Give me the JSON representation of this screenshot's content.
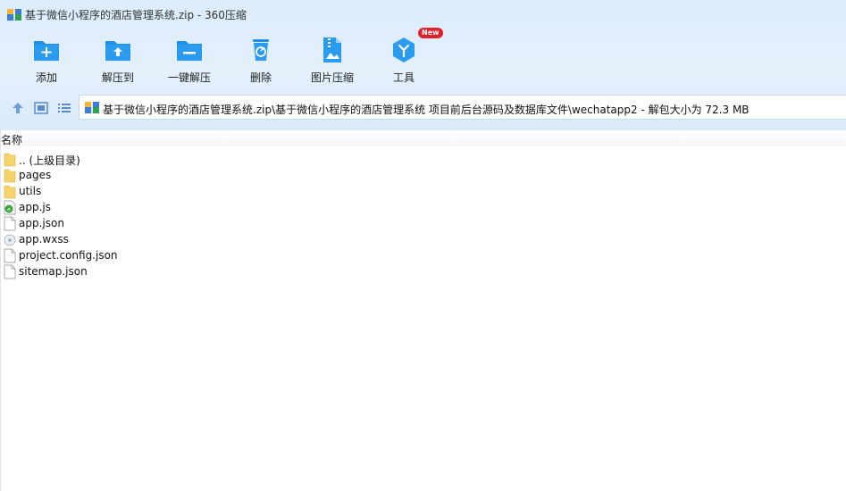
{
  "window": {
    "title": "基于微信小程序的酒店管理系统.zip - 360压缩"
  },
  "toolbar": {
    "items": [
      {
        "label": "添加",
        "icon": "add-folder-icon"
      },
      {
        "label": "解压到",
        "icon": "extract-to-icon"
      },
      {
        "label": "一键解压",
        "icon": "one-click-extract-icon"
      },
      {
        "label": "删除",
        "icon": "recycle-bin-icon"
      },
      {
        "label": "图片压缩",
        "icon": "image-compress-icon"
      },
      {
        "label": "工具",
        "icon": "tools-icon",
        "badge": "New"
      }
    ]
  },
  "nav": {
    "path": "基于微信小程序的酒店管理系统.zip\\基于微信小程序的酒店管理系统 项目前后台源码及数据库文件\\wechatapp2 - 解包大小为 72.3 MB"
  },
  "list": {
    "column_name": "名称",
    "files": [
      {
        "name": ".. (上级目录)",
        "icon": "folder-icon"
      },
      {
        "name": "pages",
        "icon": "folder-icon"
      },
      {
        "name": "utils",
        "icon": "folder-icon"
      },
      {
        "name": "app.js",
        "icon": "javascript-file-icon"
      },
      {
        "name": "app.json",
        "icon": "document-icon"
      },
      {
        "name": "app.wxss",
        "icon": "disc-file-icon"
      },
      {
        "name": "project.config.json",
        "icon": "document-icon"
      },
      {
        "name": "sitemap.json",
        "icon": "document-icon"
      }
    ]
  },
  "colors": {
    "accent": "#1e90e8",
    "chrome": "#dcecfb",
    "badge": "#e0202a",
    "folder": "#f6d36b"
  }
}
